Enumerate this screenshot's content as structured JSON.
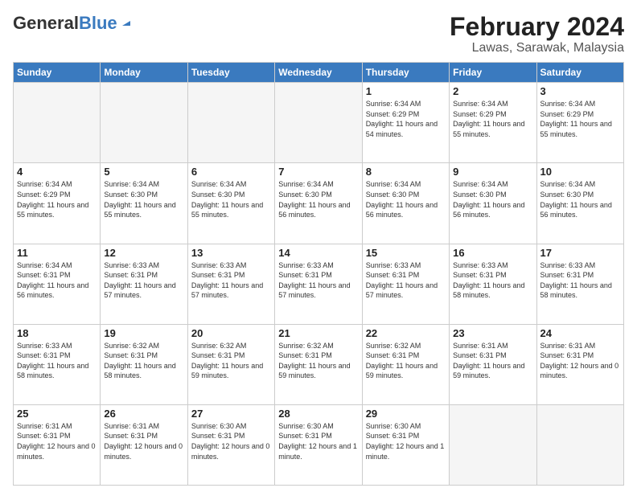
{
  "logo": {
    "general": "General",
    "blue": "Blue"
  },
  "title": "February 2024",
  "subtitle": "Lawas, Sarawak, Malaysia",
  "days_of_week": [
    "Sunday",
    "Monday",
    "Tuesday",
    "Wednesday",
    "Thursday",
    "Friday",
    "Saturday"
  ],
  "weeks": [
    [
      {
        "day": "",
        "empty": true
      },
      {
        "day": "",
        "empty": true
      },
      {
        "day": "",
        "empty": true
      },
      {
        "day": "",
        "empty": true
      },
      {
        "day": "1",
        "sunrise": "6:34 AM",
        "sunset": "6:29 PM",
        "daylight": "11 hours and 54 minutes."
      },
      {
        "day": "2",
        "sunrise": "6:34 AM",
        "sunset": "6:29 PM",
        "daylight": "11 hours and 55 minutes."
      },
      {
        "day": "3",
        "sunrise": "6:34 AM",
        "sunset": "6:29 PM",
        "daylight": "11 hours and 55 minutes."
      }
    ],
    [
      {
        "day": "4",
        "sunrise": "6:34 AM",
        "sunset": "6:29 PM",
        "daylight": "11 hours and 55 minutes."
      },
      {
        "day": "5",
        "sunrise": "6:34 AM",
        "sunset": "6:30 PM",
        "daylight": "11 hours and 55 minutes."
      },
      {
        "day": "6",
        "sunrise": "6:34 AM",
        "sunset": "6:30 PM",
        "daylight": "11 hours and 55 minutes."
      },
      {
        "day": "7",
        "sunrise": "6:34 AM",
        "sunset": "6:30 PM",
        "daylight": "11 hours and 56 minutes."
      },
      {
        "day": "8",
        "sunrise": "6:34 AM",
        "sunset": "6:30 PM",
        "daylight": "11 hours and 56 minutes."
      },
      {
        "day": "9",
        "sunrise": "6:34 AM",
        "sunset": "6:30 PM",
        "daylight": "11 hours and 56 minutes."
      },
      {
        "day": "10",
        "sunrise": "6:34 AM",
        "sunset": "6:30 PM",
        "daylight": "11 hours and 56 minutes."
      }
    ],
    [
      {
        "day": "11",
        "sunrise": "6:34 AM",
        "sunset": "6:31 PM",
        "daylight": "11 hours and 56 minutes."
      },
      {
        "day": "12",
        "sunrise": "6:33 AM",
        "sunset": "6:31 PM",
        "daylight": "11 hours and 57 minutes."
      },
      {
        "day": "13",
        "sunrise": "6:33 AM",
        "sunset": "6:31 PM",
        "daylight": "11 hours and 57 minutes."
      },
      {
        "day": "14",
        "sunrise": "6:33 AM",
        "sunset": "6:31 PM",
        "daylight": "11 hours and 57 minutes."
      },
      {
        "day": "15",
        "sunrise": "6:33 AM",
        "sunset": "6:31 PM",
        "daylight": "11 hours and 57 minutes."
      },
      {
        "day": "16",
        "sunrise": "6:33 AM",
        "sunset": "6:31 PM",
        "daylight": "11 hours and 58 minutes."
      },
      {
        "day": "17",
        "sunrise": "6:33 AM",
        "sunset": "6:31 PM",
        "daylight": "11 hours and 58 minutes."
      }
    ],
    [
      {
        "day": "18",
        "sunrise": "6:33 AM",
        "sunset": "6:31 PM",
        "daylight": "11 hours and 58 minutes."
      },
      {
        "day": "19",
        "sunrise": "6:32 AM",
        "sunset": "6:31 PM",
        "daylight": "11 hours and 58 minutes."
      },
      {
        "day": "20",
        "sunrise": "6:32 AM",
        "sunset": "6:31 PM",
        "daylight": "11 hours and 59 minutes."
      },
      {
        "day": "21",
        "sunrise": "6:32 AM",
        "sunset": "6:31 PM",
        "daylight": "11 hours and 59 minutes."
      },
      {
        "day": "22",
        "sunrise": "6:32 AM",
        "sunset": "6:31 PM",
        "daylight": "11 hours and 59 minutes."
      },
      {
        "day": "23",
        "sunrise": "6:31 AM",
        "sunset": "6:31 PM",
        "daylight": "11 hours and 59 minutes."
      },
      {
        "day": "24",
        "sunrise": "6:31 AM",
        "sunset": "6:31 PM",
        "daylight": "12 hours and 0 minutes."
      }
    ],
    [
      {
        "day": "25",
        "sunrise": "6:31 AM",
        "sunset": "6:31 PM",
        "daylight": "12 hours and 0 minutes."
      },
      {
        "day": "26",
        "sunrise": "6:31 AM",
        "sunset": "6:31 PM",
        "daylight": "12 hours and 0 minutes."
      },
      {
        "day": "27",
        "sunrise": "6:30 AM",
        "sunset": "6:31 PM",
        "daylight": "12 hours and 0 minutes."
      },
      {
        "day": "28",
        "sunrise": "6:30 AM",
        "sunset": "6:31 PM",
        "daylight": "12 hours and 1 minute."
      },
      {
        "day": "29",
        "sunrise": "6:30 AM",
        "sunset": "6:31 PM",
        "daylight": "12 hours and 1 minute."
      },
      {
        "day": "",
        "empty": true
      },
      {
        "day": "",
        "empty": true
      }
    ]
  ]
}
